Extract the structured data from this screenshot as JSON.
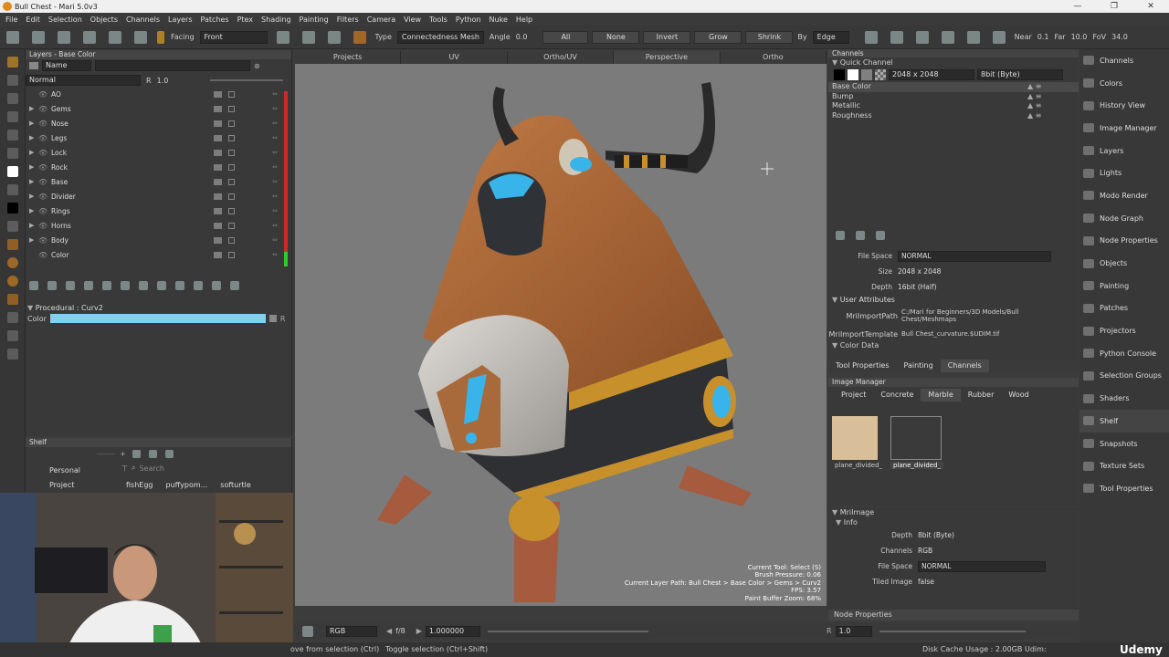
{
  "window": {
    "title": "Bull Chest - Mari 5.0v3"
  },
  "menu": [
    "File",
    "Edit",
    "Selection",
    "Objects",
    "Channels",
    "Layers",
    "Patches",
    "Ptex",
    "Shading",
    "Painting",
    "Filters",
    "Camera",
    "View",
    "Tools",
    "Python",
    "Nuke",
    "Help"
  ],
  "toolbar": {
    "facing_label": "Facing",
    "facing_value": "Front",
    "type_label": "Type",
    "type_value": "Connectedness Mesh",
    "angle_label": "Angle",
    "angle_value": "0.0",
    "btn_all": "All",
    "btn_none": "None",
    "btn_invert": "Invert",
    "btn_grow": "Grow",
    "btn_shrink": "Shrink",
    "by_label": "By",
    "by_value": "Edge",
    "near_label": "Near",
    "near_value": "0.1",
    "far_label": "Far",
    "far_value": "10.0",
    "fov_label": "FoV",
    "fov_value": "34.0"
  },
  "layers": {
    "header": "Layers - Base Color",
    "filter_placeholder": "Name",
    "blend": "Normal",
    "opacity_label": "R",
    "opacity": "1.0",
    "items": [
      {
        "name": "AO",
        "expand": ""
      },
      {
        "name": "Gems",
        "expand": "▶"
      },
      {
        "name": "Nose",
        "expand": "▶"
      },
      {
        "name": "Legs",
        "expand": "▶"
      },
      {
        "name": "Lock",
        "expand": "▶"
      },
      {
        "name": "Rock",
        "expand": "▶"
      },
      {
        "name": "Base",
        "expand": "▶"
      },
      {
        "name": "Divider",
        "expand": "▶"
      },
      {
        "name": "Rings",
        "expand": "▶"
      },
      {
        "name": "Horns",
        "expand": "▶"
      },
      {
        "name": "Body",
        "expand": "▶"
      },
      {
        "name": "Color",
        "expand": ""
      }
    ],
    "procedural_header": "Procedural : Curv2",
    "color_label": "Color",
    "color_value": "#7fd0f3"
  },
  "shelf": {
    "header": "Shelf",
    "items": [
      "Personal",
      "Project"
    ],
    "search_placeholder": "Search",
    "thumbs": [
      "fishEgg",
      "puffypom...",
      "softurtle"
    ]
  },
  "viewport": {
    "tabs": [
      "Projects",
      "UV",
      "Ortho/UV",
      "Perspective",
      "Ortho"
    ],
    "active_tab": "Perspective",
    "hud": [
      "Current Tool: Select (S)",
      "Brush Pressure: 0.06",
      "Current Layer Path: Bull Chest > Base Color > Gems > Curv2",
      "FPS: 3.57",
      "Paint Buffer Zoom: 68%"
    ],
    "bottom": {
      "mode": "RGB",
      "fstop": "f/8",
      "exposure": "1.000000",
      "right": "1.0"
    }
  },
  "channels": {
    "header": "Channels",
    "quick": "Quick Channel",
    "size": "2048 x 2048",
    "depth": "8bit (Byte)",
    "items": [
      "Base Color",
      "Bump",
      "Metallic",
      "Roughness"
    ],
    "props": {
      "file_space_label": "File Space",
      "file_space": "NORMAL",
      "size_label": "Size",
      "size": "2048 x 2048",
      "depth_label": "Depth",
      "depth": "16bit (Half)",
      "user_attr": "User Attributes",
      "import_path_label": "MriImportPath",
      "import_path": "C:/Mari for Beginners/3D Models/Bull Chest/Meshmaps",
      "import_tmpl_label": "MriImportTemplate",
      "import_tmpl": "Bull Chest_curvature.$UDIM.tif",
      "color_data": "Color Data"
    },
    "tabs": [
      "Tool Properties",
      "Painting",
      "Channels"
    ]
  },
  "image_manager": {
    "header": "Image Manager",
    "tabs": [
      "Project",
      "Concrete",
      "Marble",
      "Rubber",
      "Wood"
    ],
    "active_tab": "Marble",
    "images": [
      "plane_divided_",
      "plane_divided_"
    ]
  },
  "mri_image": {
    "header": "MriImage",
    "info": "Info",
    "depth_label": "Depth",
    "depth": "8bit (Byte)",
    "channels_label": "Channels",
    "channels": "RGB",
    "file_space_label": "File Space",
    "file_space": "NORMAL",
    "tiled_label": "Tiled Image",
    "tiled": "false",
    "node_props": "Node Properties"
  },
  "right_dock": [
    "Channels",
    "Colors",
    "History View",
    "Image Manager",
    "Layers",
    "Lights",
    "Modo Render",
    "Node Graph",
    "Node Properties",
    "Objects",
    "Painting",
    "Patches",
    "Projectors",
    "Python Console",
    "Selection Groups",
    "Shaders",
    "Shelf",
    "Snapshots",
    "Texture Sets",
    "Tool Properties"
  ],
  "right_dock_active": "Shelf",
  "status": {
    "left": "ove from selection (Ctrl)",
    "mid": "Toggle selection (Ctrl+Shift)",
    "cache": "Disk Cache Usage : 2.00GB",
    "udim": "Udim:"
  },
  "watermark": "Udemy"
}
